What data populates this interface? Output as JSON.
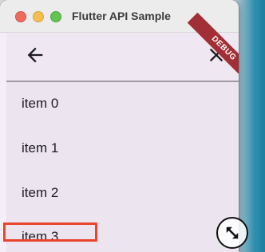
{
  "window": {
    "title": "Flutter API Sample"
  },
  "appbar": {
    "back_icon": "arrow-back-icon",
    "close_icon": "close-icon"
  },
  "banner": {
    "label": "DEBUG"
  },
  "list": {
    "items": [
      "item 0",
      "item 1",
      "item 2",
      "item 3"
    ]
  },
  "colors": {
    "debug_banner": "#a12f35",
    "highlight_box": "#e8452b"
  }
}
